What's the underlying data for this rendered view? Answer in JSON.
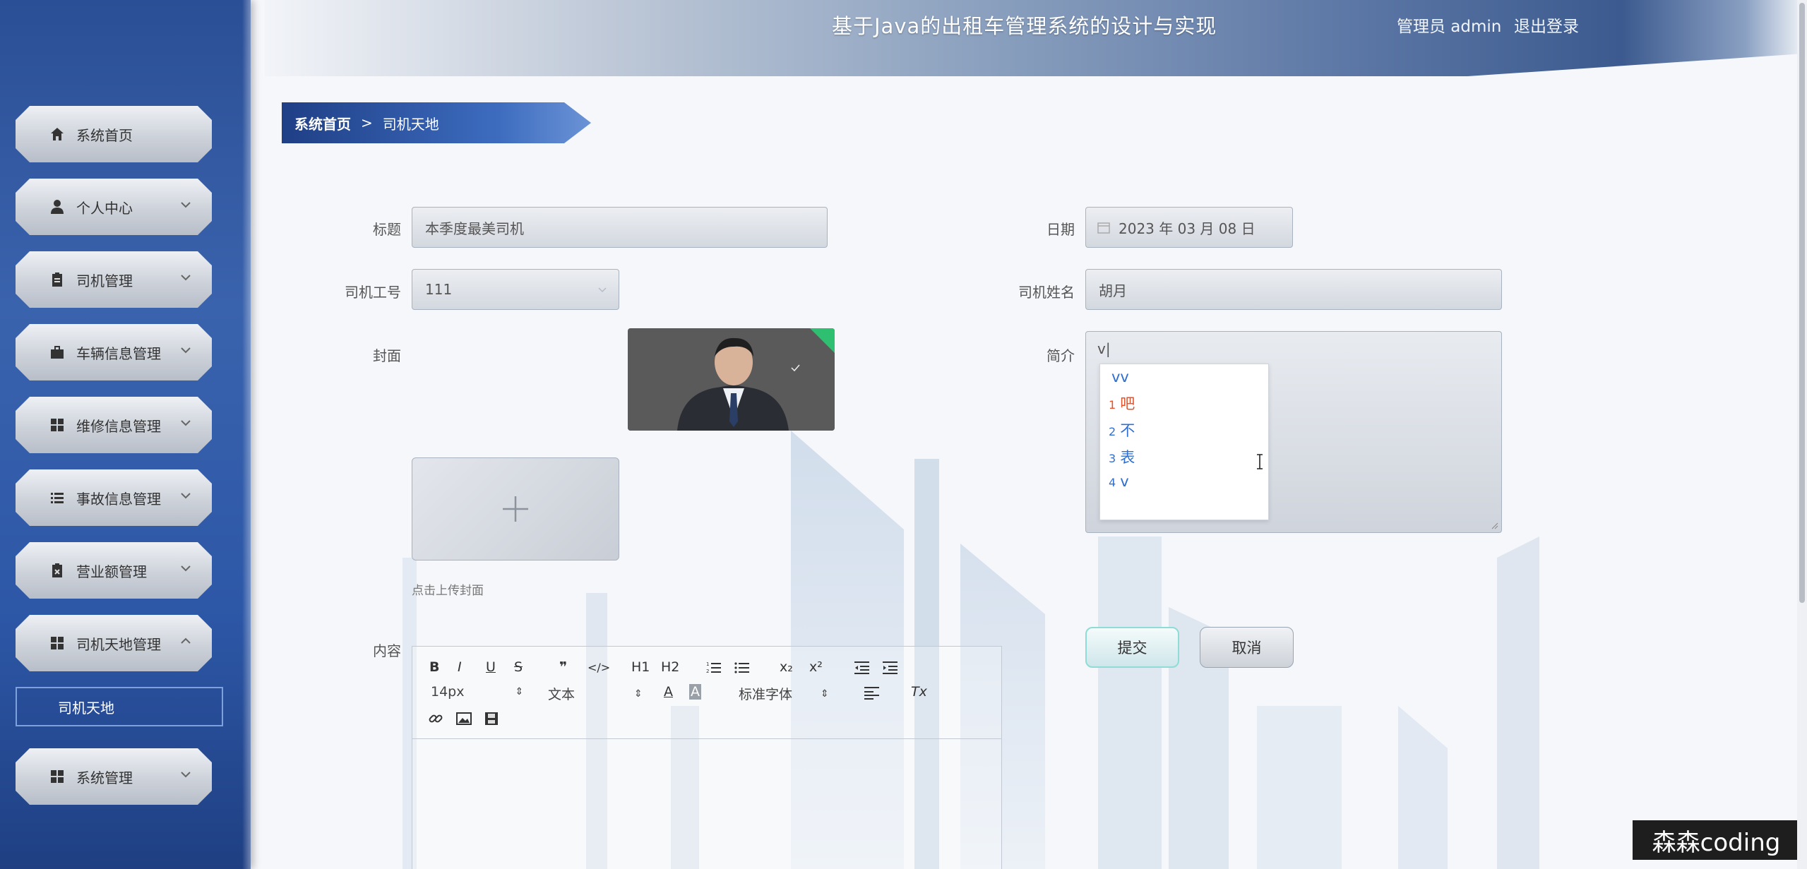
{
  "header": {
    "title": "基于Java的出租车管理系统的设计与实现",
    "user": "管理员 admin",
    "logout": "退出登录"
  },
  "sidebar": {
    "items": [
      {
        "label": "系统首页",
        "icon": "home-icon"
      },
      {
        "label": "个人中心",
        "icon": "user-icon"
      },
      {
        "label": "司机管理",
        "icon": "clipboard-icon"
      },
      {
        "label": "车辆信息管理",
        "icon": "briefcase-icon"
      },
      {
        "label": "维修信息管理",
        "icon": "grid-icon"
      },
      {
        "label": "事故信息管理",
        "icon": "list-icon"
      },
      {
        "label": "营业额管理",
        "icon": "clipboard-x-icon"
      },
      {
        "label": "司机天地管理",
        "icon": "grid-icon"
      },
      {
        "label": "系统管理",
        "icon": "grid-icon"
      }
    ],
    "submenu": "司机天地"
  },
  "breadcrumb": {
    "home": "系统首页",
    "separator": ">",
    "current": "司机天地"
  },
  "form": {
    "title_label": "标题",
    "title_value": "本季度最美司机",
    "date_label": "日期",
    "date_value": "2023 年 03 月 08 日",
    "driver_id_label": "司机工号",
    "driver_id_value": "111",
    "driver_name_label": "司机姓名",
    "driver_name_value": "胡月",
    "cover_label": "封面",
    "upload_tip": "点击上传封面",
    "intro_label": "简介",
    "intro_value": "v|",
    "content_label": "内容",
    "submit": "提交",
    "cancel": "取消"
  },
  "ime": {
    "composition": "vv",
    "candidates": [
      {
        "num": "1",
        "text": "吧"
      },
      {
        "num": "2",
        "text": "不"
      },
      {
        "num": "3",
        "text": "表"
      },
      {
        "num": "4",
        "text": "v"
      }
    ]
  },
  "editor": {
    "toolbar_row1": [
      "B",
      "I",
      "U",
      "S",
      "❞",
      "</>",
      "H1",
      "H2",
      "ordered-list",
      "bullet-list",
      "x₂",
      "x²",
      "outdent",
      "indent"
    ],
    "font_size": "14px",
    "header_select": "文本",
    "font_select": "标准字体",
    "clean": "Tx"
  },
  "watermark": "森森coding",
  "colors": {
    "sidebar": "#2d58a7",
    "breadcrumb": "#1f3f86",
    "submit_border": "#8fdcd6",
    "ime_selected": "#e4522b",
    "ime_text": "#2f6fd0"
  }
}
